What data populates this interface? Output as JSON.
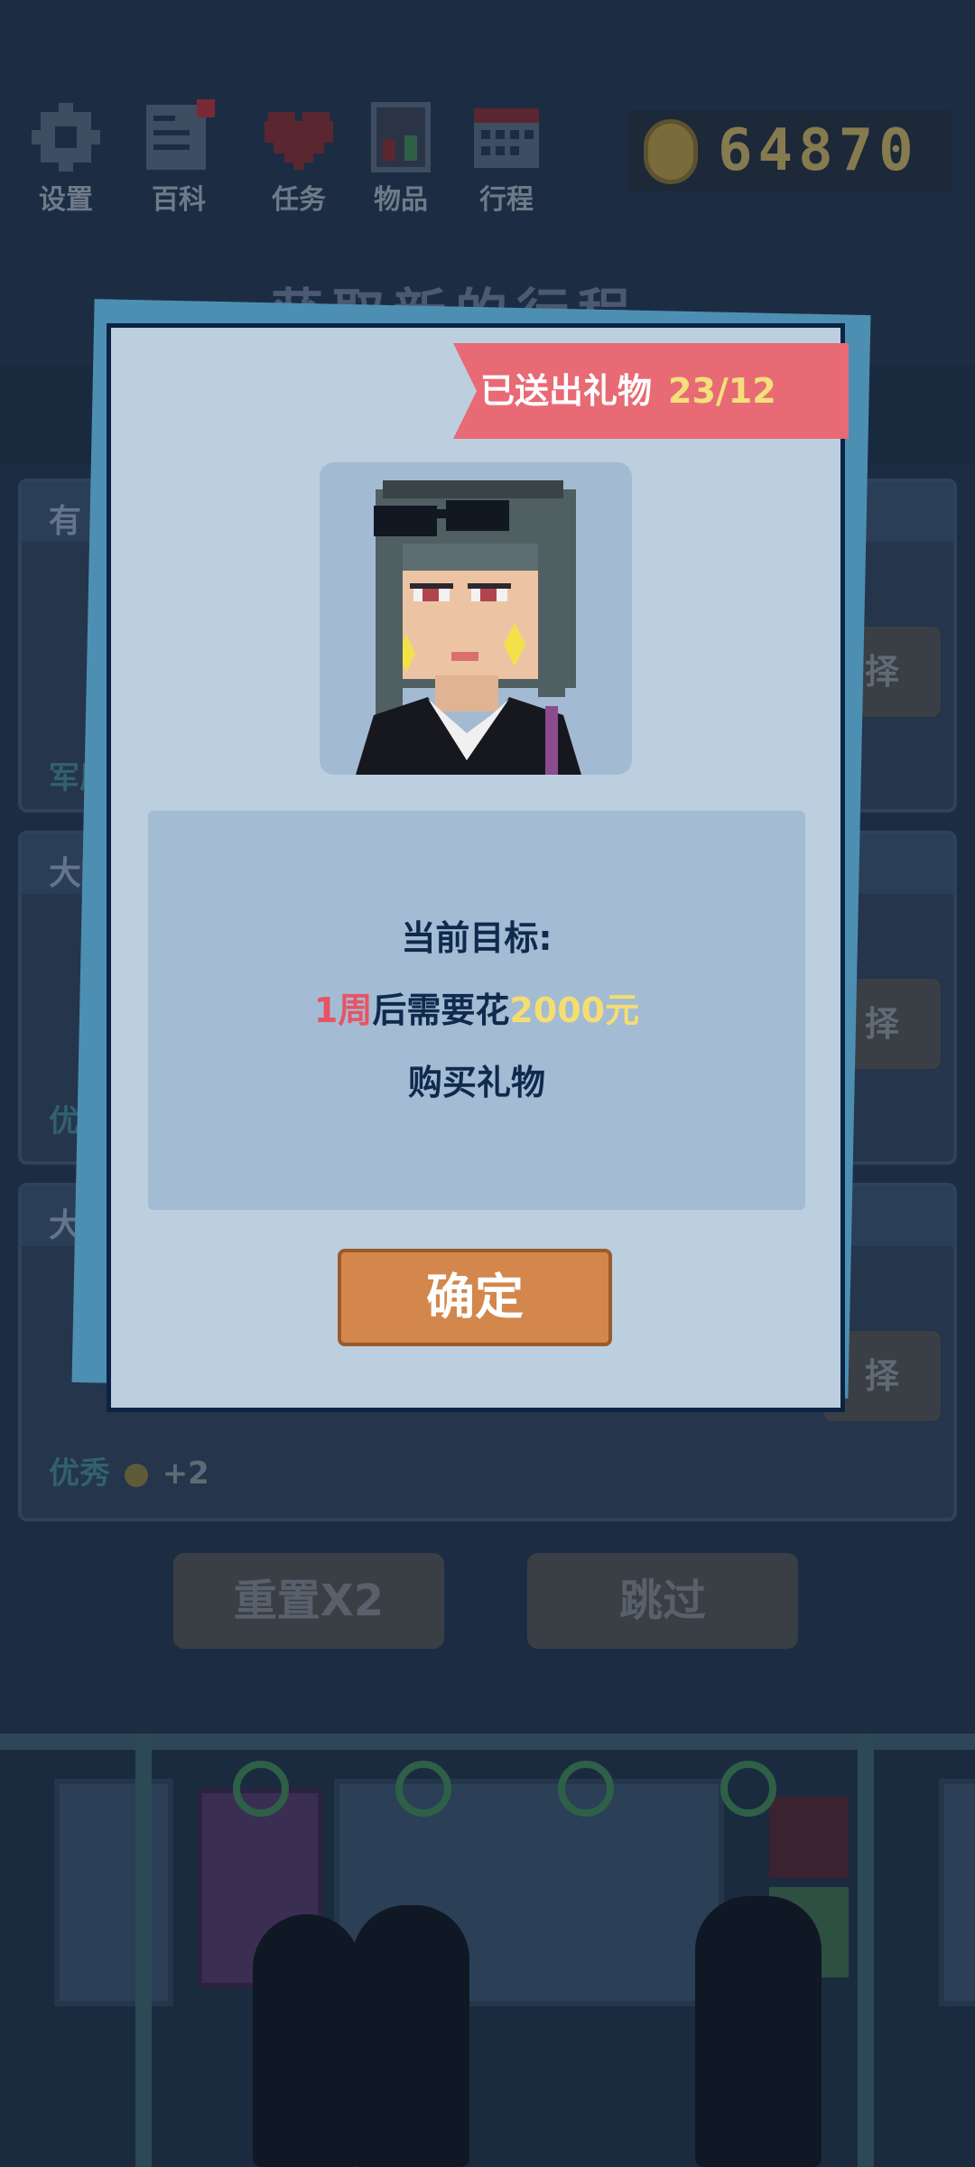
{
  "toolbar": {
    "items": [
      {
        "label": "设置",
        "icon": "gear-icon"
      },
      {
        "label": "百科",
        "icon": "book-icon"
      },
      {
        "label": "任务",
        "icon": "heart-icon"
      },
      {
        "label": "物品",
        "icon": "box-icon"
      },
      {
        "label": "行程",
        "icon": "calendar-icon"
      }
    ],
    "coins": "64870"
  },
  "background": {
    "title": "获取新的行程",
    "cards": [
      {
        "header": "有",
        "tag": "军原",
        "select": "择"
      },
      {
        "header": "大打",
        "tag": "优秀",
        "select": "择"
      },
      {
        "header": "大完",
        "tag": "优秀",
        "reward": "+2",
        "select": "择"
      }
    ],
    "buttons": {
      "reset": "重置X2",
      "skip": "跳过"
    }
  },
  "dialog": {
    "ribbon_label": "已送出礼物",
    "ribbon_count": "23/12",
    "goal_title": "当前目标:",
    "goal_line_period": "1周",
    "goal_line_mid": "后需要花",
    "goal_line_amount": "2000元",
    "goal_line_end": "购买礼物",
    "confirm_label": "确定"
  },
  "colors": {
    "dialog_bg": "#bccfdf",
    "ribbon": "#e86a74",
    "confirm": "#d3874c",
    "highlight_red": "#e65465",
    "highlight_gold": "#f4de72"
  }
}
